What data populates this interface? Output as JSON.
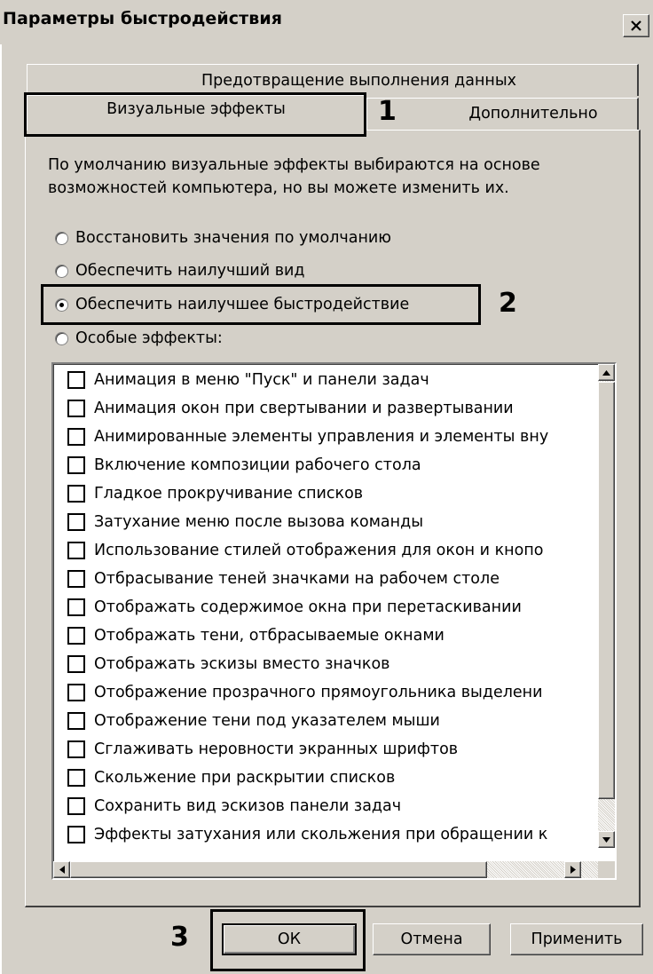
{
  "window": {
    "title": "Параметры быстродействия",
    "close_label": "close"
  },
  "tabs": {
    "row1": "Предотвращение выполнения данных",
    "active": "Визуальные эффекты",
    "extra": "Дополнительно"
  },
  "description": "По умолчанию визуальные эффекты выбираются на основе возможностей компьютера, но вы можете изменить их.",
  "radios": [
    {
      "label": "Восстановить значения по умолчанию",
      "checked": false
    },
    {
      "label": "Обеспечить наилучший вид",
      "checked": false
    },
    {
      "label": "Обеспечить наилучшее быстродействие",
      "checked": true
    },
    {
      "label": "Особые эффекты:",
      "checked": false
    }
  ],
  "effects": [
    "Анимация в меню \"Пуск\" и панели задач",
    "Анимация окон при свертывании и развертывании",
    "Анимированные элементы управления и элементы вну",
    "Включение композиции рабочего стола",
    "Гладкое прокручивание списков",
    "Затухание меню после вызова команды",
    "Использование стилей отображения для окон и кнопо",
    "Отбрасывание теней значками на рабочем столе",
    "Отображать содержимое окна при перетаскивании",
    "Отображать тени, отбрасываемые окнами",
    "Отображать эскизы вместо значков",
    "Отображение прозрачного прямоугольника выделени",
    "Отображение тени под указателем мыши",
    "Сглаживать неровности экранных шрифтов",
    "Скольжение при раскрытии списков",
    "Сохранить вид эскизов панели задач",
    "Эффекты затухания или скольжения при обращении к"
  ],
  "buttons": {
    "ok": "ОК",
    "cancel": "Отмена",
    "apply": "Применить"
  },
  "callouts": {
    "one": "1",
    "two": "2",
    "three": "3"
  }
}
